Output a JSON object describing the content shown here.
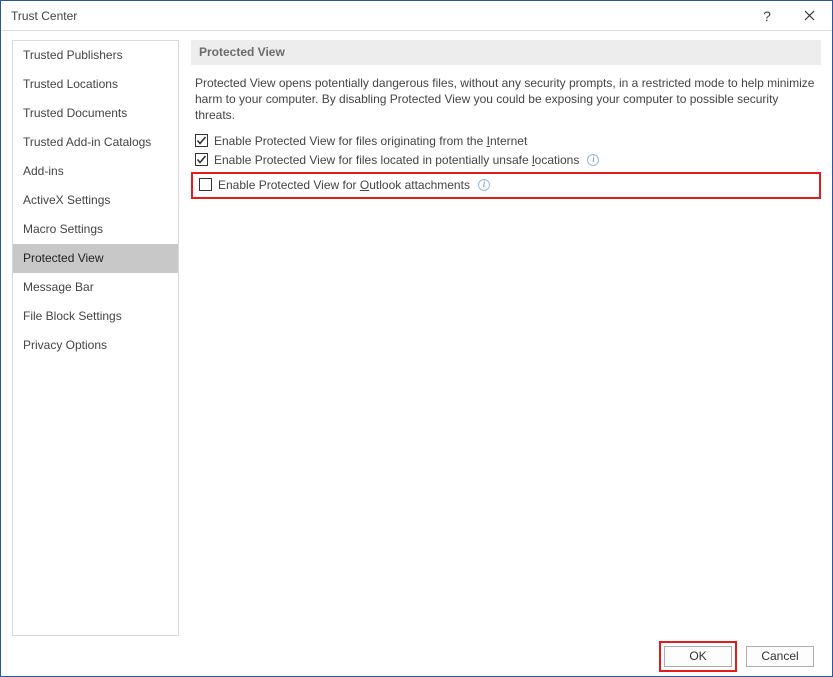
{
  "titlebar": {
    "title": "Trust Center"
  },
  "sidebar": {
    "items": [
      {
        "label": "Trusted Publishers",
        "name": "trusted-publishers"
      },
      {
        "label": "Trusted Locations",
        "name": "trusted-locations"
      },
      {
        "label": "Trusted Documents",
        "name": "trusted-documents"
      },
      {
        "label": "Trusted Add-in Catalogs",
        "name": "trusted-addin-catalogs"
      },
      {
        "label": "Add-ins",
        "name": "add-ins"
      },
      {
        "label": "ActiveX Settings",
        "name": "activex-settings"
      },
      {
        "label": "Macro Settings",
        "name": "macro-settings"
      },
      {
        "label": "Protected View",
        "name": "protected-view",
        "selected": true
      },
      {
        "label": "Message Bar",
        "name": "message-bar"
      },
      {
        "label": "File Block Settings",
        "name": "file-block-settings"
      },
      {
        "label": "Privacy Options",
        "name": "privacy-options"
      }
    ]
  },
  "content": {
    "section_title": "Protected View",
    "description": "Protected View opens potentially dangerous files, without any security prompts, in a restricted mode to help minimize harm to your computer. By disabling Protected View you could be exposing your computer to possible security threats.",
    "options": [
      {
        "pre": "Enable Protected View for files originating from the ",
        "accel": "I",
        "post": "nternet",
        "checked": true,
        "info": false,
        "name": "enable-pv-internet"
      },
      {
        "pre": "Enable Protected View for files located in potentially unsafe ",
        "accel": "l",
        "post": "ocations",
        "checked": true,
        "info": true,
        "name": "enable-pv-unsafe-locations"
      },
      {
        "pre": "Enable Protected View for ",
        "accel": "O",
        "post": "utlook attachments",
        "checked": false,
        "info": true,
        "highlighted": true,
        "name": "enable-pv-outlook"
      }
    ]
  },
  "footer": {
    "ok_label": "OK",
    "cancel_label": "Cancel"
  }
}
